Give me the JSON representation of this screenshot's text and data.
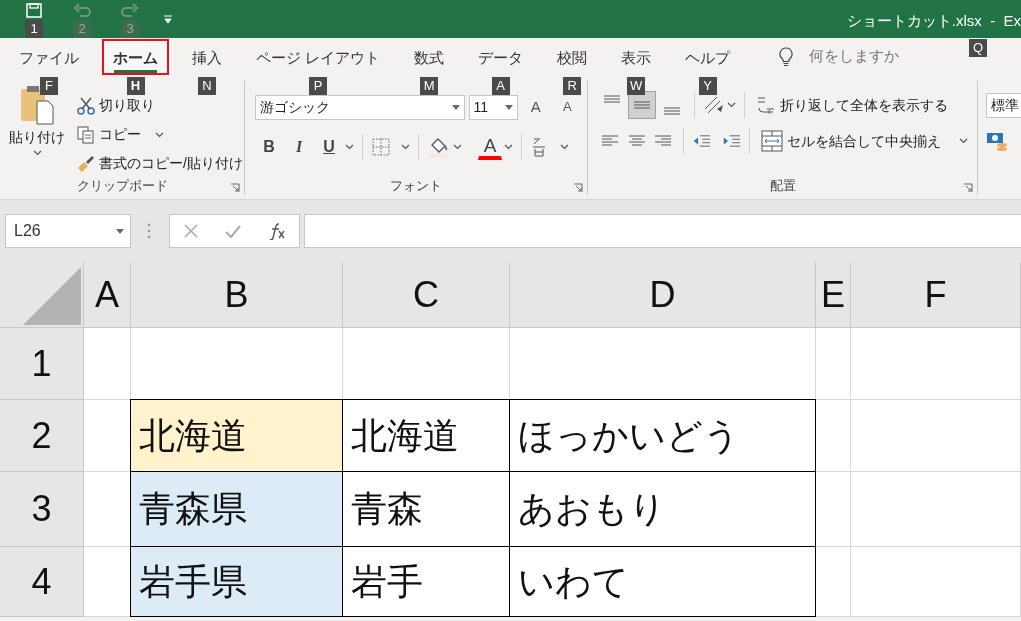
{
  "title_bar": {
    "quick_access": [
      {
        "kind": "save",
        "key_tip": "1",
        "disabled": false
      },
      {
        "kind": "undo",
        "key_tip": "2",
        "disabled": true
      },
      {
        "kind": "redo",
        "key_tip": "3",
        "disabled": true
      }
    ],
    "title": "ショートカット.xlsx  -  Ex"
  },
  "tabs": [
    {
      "label": "ファイル",
      "key_tip": "F",
      "selected": false
    },
    {
      "label": "ホーム",
      "key_tip": "H",
      "selected": true
    },
    {
      "label": "挿入",
      "key_tip": "N",
      "selected": false
    },
    {
      "label": "ページ レイアウト",
      "key_tip": "P",
      "selected": false
    },
    {
      "label": "数式",
      "key_tip": "M",
      "selected": false
    },
    {
      "label": "データ",
      "key_tip": "A",
      "selected": false
    },
    {
      "label": "校閲",
      "key_tip": "R",
      "selected": false
    },
    {
      "label": "表示",
      "key_tip": "W",
      "selected": false
    },
    {
      "label": "ヘルプ",
      "key_tip": "Y",
      "selected": false
    }
  ],
  "tell_me": {
    "placeholder": "何をしますか",
    "key_tip": "Q"
  },
  "ribbon": {
    "clipboard": {
      "paste": "貼り付け",
      "cut": "切り取り",
      "copy": "コピー",
      "format_painter": "書式のコピー/貼り付け",
      "label": "クリップボード"
    },
    "font": {
      "font_name": "游ゴシック",
      "font_size": "11",
      "grow": "A",
      "shrink": "A",
      "styles": [
        {
          "kind": "bold",
          "label": "B"
        },
        {
          "kind": "italic",
          "label": "I"
        },
        {
          "kind": "underline",
          "label": "U"
        }
      ],
      "font_color": "A",
      "label": "フォント"
    },
    "alignment": {
      "vertical": [
        {
          "kind": "top",
          "selected": false
        },
        {
          "kind": "middle",
          "selected": true
        },
        {
          "kind": "bottom",
          "selected": false
        }
      ],
      "wrap_text": "折り返して全体を表示する",
      "merge_center": "セルを結合して中央揃え",
      "label": "配置"
    },
    "number": {
      "format": "標準"
    }
  },
  "formula_bar": {
    "name_box": "L26"
  },
  "sheet": {
    "columns": [
      "A",
      "B",
      "C",
      "D",
      "E",
      "F"
    ],
    "rows": [
      {
        "header": "1"
      },
      {
        "header": "2",
        "cells": {
          "B": {
            "text": "北海道",
            "color": "#fff2cc",
            "bordered": true
          },
          "C": {
            "text": "北海道",
            "bordered": true
          },
          "D": {
            "text": "ほっかいどう",
            "bordered": true
          }
        }
      },
      {
        "header": "3",
        "cells": {
          "B": {
            "text": "青森県",
            "color": "#ddebf7",
            "bordered": true
          },
          "C": {
            "text": "青森",
            "bordered": true
          },
          "D": {
            "text": "あおもり",
            "bordered": true
          }
        }
      },
      {
        "header": "4",
        "cells": {
          "B": {
            "text": "岩手県",
            "color": "#ddebf7",
            "bordered": true
          },
          "C": {
            "text": "岩手",
            "bordered": true
          },
          "D": {
            "text": "いわて",
            "bordered": true
          }
        }
      }
    ]
  }
}
